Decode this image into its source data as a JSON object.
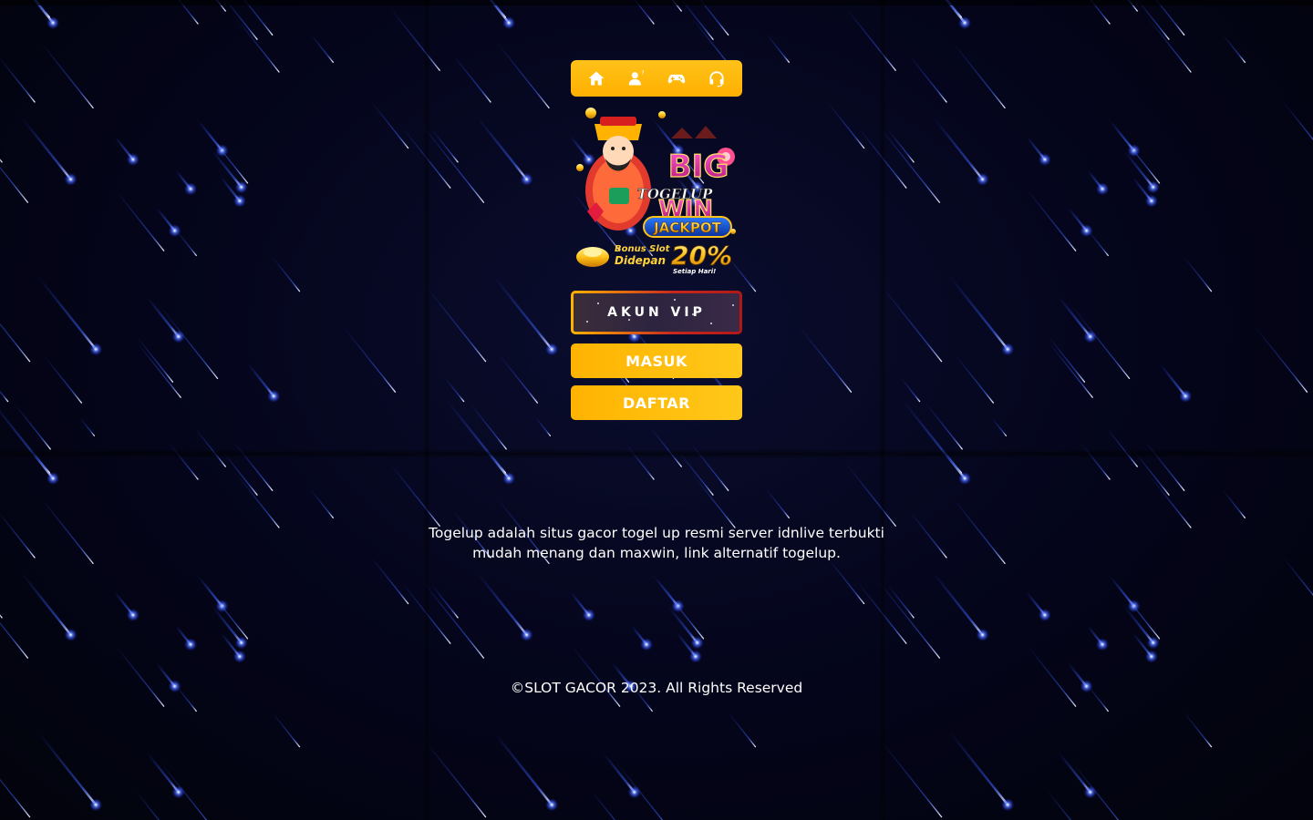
{
  "nav": {
    "items": [
      {
        "icon": "home-icon"
      },
      {
        "icon": "user-help-icon"
      },
      {
        "icon": "gamepad-icon"
      },
      {
        "icon": "headset-icon"
      }
    ],
    "background_color": "#ffb300"
  },
  "banner": {
    "line1": "BIG",
    "brand": "TOGELUP",
    "line2": "WIN",
    "jackpot": "JACKPOT",
    "bonus_line1": "Bonus Slot",
    "bonus_line2": "Didepan",
    "percent": "20%",
    "tagline": "Setiap Hari!"
  },
  "buttons": {
    "vip_label": "AKUN VIP",
    "login_label": "MASUK",
    "register_label": "DAFTAR"
  },
  "description": "Togelup adalah situs gacor togel up resmi server idnlive terbukti mudah menang dan maxwin, link alternatif togelup.",
  "footer": "©SLOT GACOR 2023. All Rights Reserved",
  "colors": {
    "accent": "#ffb300",
    "vip_border_start": "#ffb300",
    "vip_border_end": "#b01818",
    "background": "#03040d"
  }
}
